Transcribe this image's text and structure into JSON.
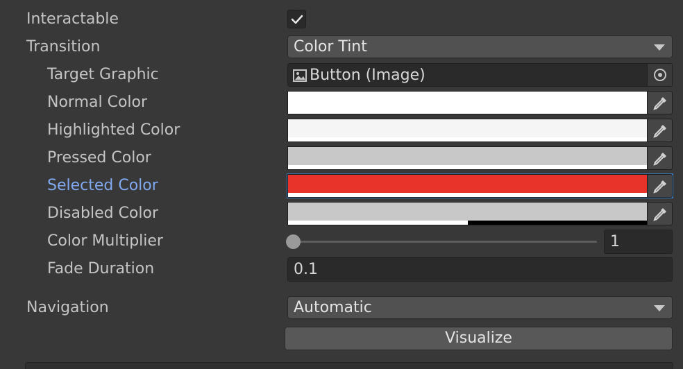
{
  "labels": {
    "interactable": "Interactable",
    "transition": "Transition",
    "target_graphic": "Target Graphic",
    "normal_color": "Normal Color",
    "highlighted_color": "Highlighted Color",
    "pressed_color": "Pressed Color",
    "selected_color": "Selected Color",
    "disabled_color": "Disabled Color",
    "color_multiplier": "Color Multiplier",
    "fade_duration": "Fade Duration",
    "navigation": "Navigation"
  },
  "interactable": {
    "checked": true,
    "icon": "checkmark-icon"
  },
  "transition": {
    "value": "Color Tint",
    "icon": "dropdown-arrow-icon"
  },
  "target_graphic": {
    "value": "Button (Image)",
    "icon": "image-icon",
    "picker_icon": "object-picker-icon"
  },
  "colors": {
    "normal": {
      "hex": "#FFFFFF",
      "alpha": 1.0
    },
    "highlighted": {
      "hex": "#F5F5F5",
      "alpha": 1.0
    },
    "pressed": {
      "hex": "#C8C8C8",
      "alpha": 1.0
    },
    "selected": {
      "hex": "#E8332A",
      "alpha": 1.0
    },
    "disabled": {
      "hex": "#C8C8C8",
      "alpha": 0.5
    },
    "eyedropper_icon": "eyedropper-icon"
  },
  "color_multiplier": {
    "value": "1",
    "slider_fraction": 0.0
  },
  "fade_duration": {
    "value": "0.1"
  },
  "navigation": {
    "value": "Automatic",
    "icon": "dropdown-arrow-icon"
  },
  "visualize_button": {
    "label": "Visualize"
  },
  "theme": {
    "background": "#383838",
    "selected_label": "#81A9F0",
    "focus_outline": "#3A79BB"
  }
}
